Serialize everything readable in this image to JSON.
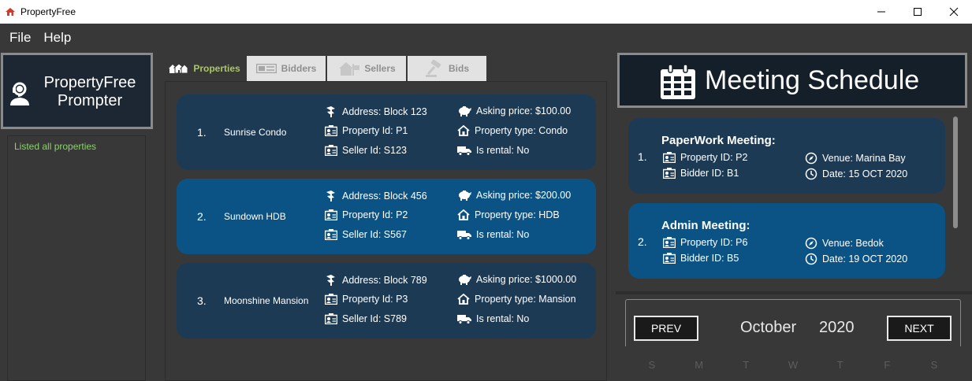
{
  "window": {
    "title": "PropertyFree"
  },
  "menu": {
    "file": "File",
    "help": "Help"
  },
  "prompter": {
    "title_line1": "PropertyFree",
    "title_line2": "Prompter",
    "result": "Listed all properties"
  },
  "tabs": [
    {
      "label": "Properties",
      "icon": "houses-icon",
      "active": true
    },
    {
      "label": "Bidders",
      "icon": "id-card-icon",
      "active": false
    },
    {
      "label": "Sellers",
      "icon": "house-sale-icon",
      "active": false
    },
    {
      "label": "Bids",
      "icon": "gavel-icon",
      "active": false
    }
  ],
  "properties": [
    {
      "index": "1.",
      "name": "Sunrise Condo",
      "address": "Address: Block 123",
      "property_id": "Property Id: P1",
      "seller_id": "Seller Id: S123",
      "asking_price": "Asking price: $100.00",
      "property_type": "Property type: Condo",
      "is_rental": "Is rental: No"
    },
    {
      "index": "2.",
      "name": "Sundown HDB",
      "address": "Address: Block 456",
      "property_id": "Property Id: P2",
      "seller_id": "Seller Id: S567",
      "asking_price": "Asking price: $200.00",
      "property_type": "Property type: HDB",
      "is_rental": "Is rental: No"
    },
    {
      "index": "3.",
      "name": "Moonshine Mansion",
      "address": "Address: Block 789",
      "property_id": "Property Id: P3",
      "seller_id": "Seller Id: S789",
      "asking_price": "Asking price: $1000.00",
      "property_type": "Property type: Mansion",
      "is_rental": "Is rental: No"
    }
  ],
  "meeting_schedule": {
    "title": "Meeting Schedule",
    "meetings": [
      {
        "index": "1.",
        "title": "PaperWork Meeting:",
        "property_id": "Property ID: P2",
        "bidder_id": "Bidder ID: B1",
        "venue": "Venue: Marina Bay",
        "date": "Date: 15 OCT 2020"
      },
      {
        "index": "2.",
        "title": "Admin Meeting:",
        "property_id": "Property ID: P6",
        "bidder_id": "Bidder ID: B5",
        "venue": "Venue: Bedok",
        "date": "Date: 19 OCT 2020"
      }
    ]
  },
  "calendar": {
    "prev": "PREV",
    "next": "NEXT",
    "month": "October",
    "year": "2020",
    "weekdays": [
      "S",
      "M",
      "T",
      "W",
      "T",
      "F",
      "S"
    ]
  },
  "colors": {
    "card_dark": "#1d3a55",
    "card_selected": "#0b5384",
    "active_tab_text": "#a9c95f",
    "result_text": "#8dd070"
  }
}
